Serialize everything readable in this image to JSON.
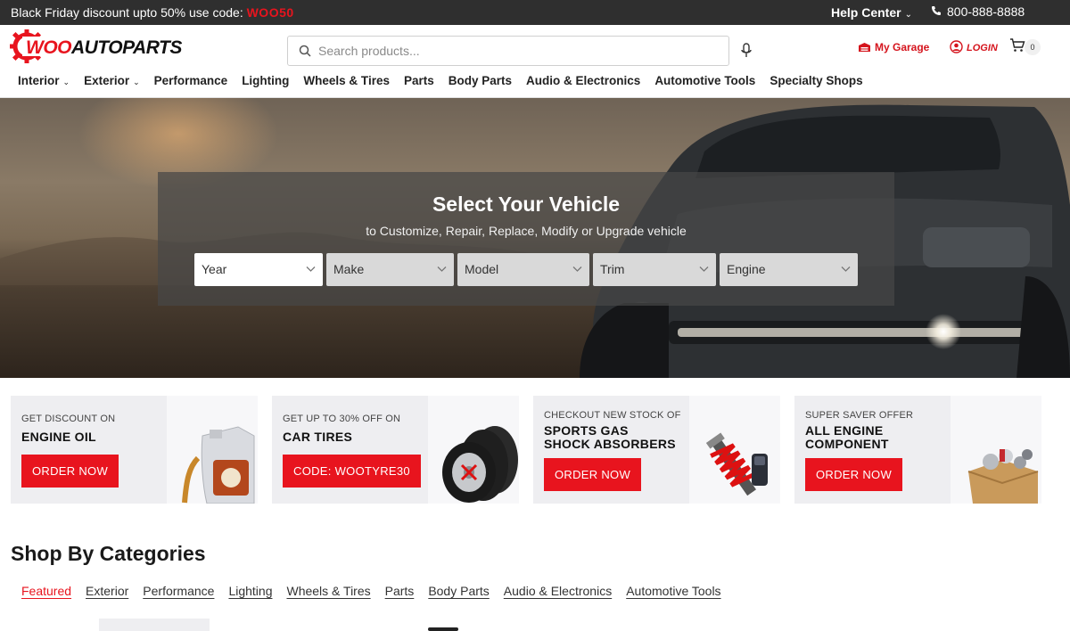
{
  "topbar": {
    "promo_text": "Black Friday discount upto 50% use code: ",
    "promo_code": "WOO50",
    "help_label": "Help Center",
    "phone": "800-888-8888"
  },
  "header": {
    "logo_prefix": "WOO",
    "logo_suffix": "AUTOPARTS",
    "search_placeholder": "Search products...",
    "garage_label": "My Garage",
    "login_label": "LOGIN",
    "cart_count": "0"
  },
  "nav": {
    "items": [
      {
        "label": "Interior",
        "dropdown": true
      },
      {
        "label": "Exterior",
        "dropdown": true
      },
      {
        "label": "Performance",
        "dropdown": false
      },
      {
        "label": "Lighting",
        "dropdown": false
      },
      {
        "label": "Wheels & Tires",
        "dropdown": false
      },
      {
        "label": "Parts",
        "dropdown": false
      },
      {
        "label": "Body Parts",
        "dropdown": false
      },
      {
        "label": "Audio & Electronics",
        "dropdown": false
      },
      {
        "label": "Automotive Tools",
        "dropdown": false
      },
      {
        "label": "Specialty Shops",
        "dropdown": false
      }
    ]
  },
  "hero": {
    "title": "Select Your Vehicle",
    "subtitle": "to Customize, Repair, Replace, Modify or Upgrade vehicle",
    "selects": [
      "Year",
      "Make",
      "Model",
      "Trim",
      "Engine"
    ]
  },
  "promos": [
    {
      "small": "GET DISCOUNT ON",
      "big_1": "ENGINE OIL",
      "big_2": "",
      "button": "ORDER NOW"
    },
    {
      "small": "GET UP TO 30% OFF ON",
      "big_1": "CAR TIRES",
      "big_2": "",
      "button": "CODE: WOOTYRE30"
    },
    {
      "small": "CHECKOUT NEW STOCK OF",
      "big_1": "SPORTS GAS",
      "big_2": "SHOCK ABSORBERS",
      "button": "ORDER NOW"
    },
    {
      "small": "SUPER SAVER OFFER",
      "big_1": "ALL ENGINE",
      "big_2": "COMPONENT",
      "button": "ORDER NOW"
    }
  ],
  "categories": {
    "title": "Shop By Categories",
    "tabs": [
      "Featured",
      "Exterior",
      "Performance",
      "Lighting",
      "Wheels & Tires",
      "Parts",
      "Body Parts",
      "Audio & Electronics",
      "Automotive Tools"
    ],
    "active_tab": "Featured"
  },
  "colors": {
    "accent": "#e8141e",
    "topbar": "#2f2f2f",
    "card_bg": "#eeeef1"
  }
}
